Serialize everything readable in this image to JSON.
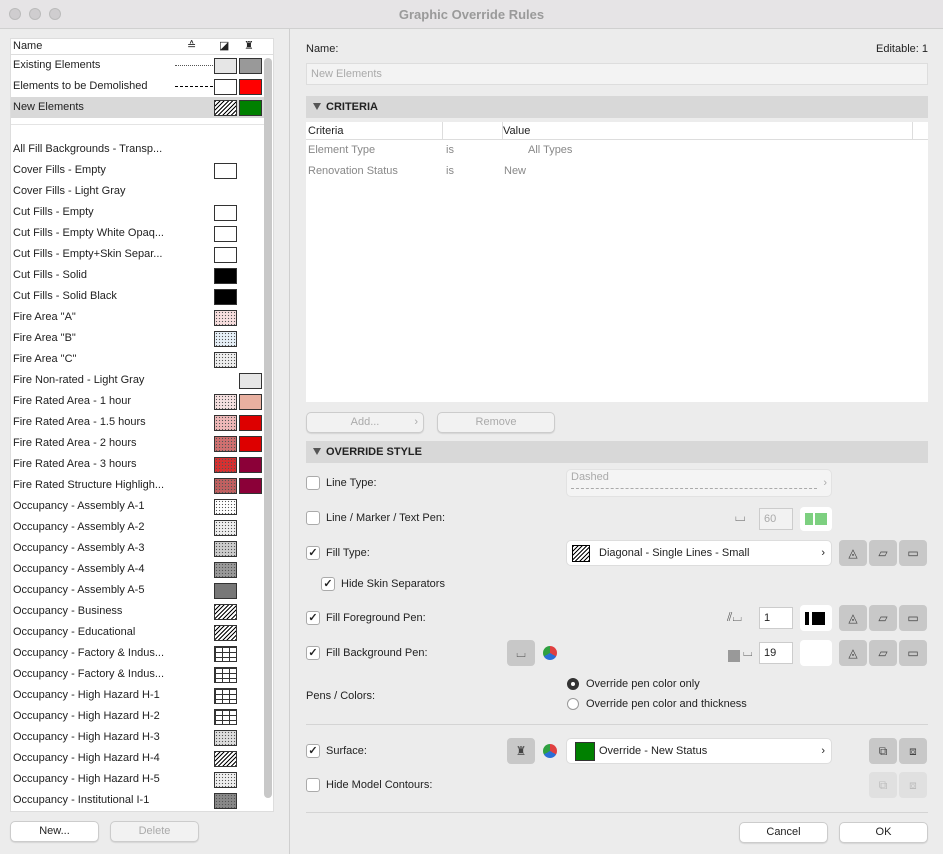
{
  "window": {
    "title": "Graphic Override Rules"
  },
  "list": {
    "headers": {
      "name": "Name",
      "line_icon": "line-type-icon",
      "fill_icon": "fill-icon",
      "surface_icon": "surface-brush-icon"
    },
    "rows": [
      {
        "label": "Existing Elements",
        "line": "dotted",
        "fill": {
          "pattern": "solid",
          "color": "#e6e6e6"
        },
        "surface": "#999999"
      },
      {
        "label": "Elements to be Demolished",
        "line": "dashed",
        "fill": {
          "pattern": "solid",
          "color": "#ffffff"
        },
        "surface": "#ff0000"
      },
      {
        "label": "New Elements",
        "fill": {
          "pattern": "hatch",
          "color": "#ffffff"
        },
        "surface": "#008000",
        "selected": true
      },
      {
        "label": "All Fill Backgrounds - Transp..."
      },
      {
        "label": "Cover Fills - Empty",
        "fill": {
          "pattern": "solid",
          "color": "#ffffff"
        }
      },
      {
        "label": "Cover Fills - Light Gray"
      },
      {
        "label": "Cut Fills - Empty",
        "fill": {
          "pattern": "solid",
          "color": "#ffffff"
        }
      },
      {
        "label": "Cut Fills - Empty White Opaq...",
        "fill": {
          "pattern": "solid",
          "color": "#ffffff"
        }
      },
      {
        "label": "Cut Fills - Empty+Skin Separ...",
        "fill": {
          "pattern": "solid",
          "color": "#ffffff"
        }
      },
      {
        "label": "Cut Fills - Solid",
        "fill": {
          "pattern": "solid",
          "color": "#000000"
        }
      },
      {
        "label": "Cut Fills - Solid Black",
        "fill": {
          "pattern": "solid",
          "color": "#000000"
        }
      },
      {
        "label": "Fire Area \"A\"",
        "fill": {
          "pattern": "dots",
          "color": "#f8dede"
        }
      },
      {
        "label": "Fire Area \"B\"",
        "fill": {
          "pattern": "dots",
          "color": "#e6f0f8"
        }
      },
      {
        "label": "Fire Area \"C\"",
        "fill": {
          "pattern": "dots",
          "color": "#eeeeee"
        }
      },
      {
        "label": "Fire Non-rated - Light Gray",
        "surface": "#e6e6e6"
      },
      {
        "label": "Fire Rated Area - 1 hour",
        "fill": {
          "pattern": "dots",
          "color": "#f6e0e0"
        },
        "surface": "#e8b0a0"
      },
      {
        "label": "Fire Rated Area - 1.5 hours",
        "fill": {
          "pattern": "dots",
          "color": "#f0b8b8"
        },
        "surface": "#dd0000"
      },
      {
        "label": "Fire Rated Area - 2 hours",
        "fill": {
          "pattern": "dots",
          "color": "#d07070"
        },
        "surface": "#dd0000"
      },
      {
        "label": "Fire Rated Area - 3 hours",
        "fill": {
          "pattern": "dots",
          "color": "#d83030"
        },
        "surface": "#8b0038"
      },
      {
        "label": "Fire Rated Structure Highligh...",
        "fill": {
          "pattern": "dots",
          "color": "#c06060"
        },
        "surface": "#8b0038"
      },
      {
        "label": "Occupancy - Assembly A-1",
        "fill": {
          "pattern": "dots",
          "color": "#ffffff"
        }
      },
      {
        "label": "Occupancy - Assembly A-2",
        "fill": {
          "pattern": "dots",
          "color": "#eeeeee"
        }
      },
      {
        "label": "Occupancy - Assembly A-3",
        "fill": {
          "pattern": "dots",
          "color": "#cccccc"
        }
      },
      {
        "label": "Occupancy - Assembly A-4",
        "fill": {
          "pattern": "dots",
          "color": "#999999"
        }
      },
      {
        "label": "Occupancy - Assembly A-5",
        "fill": {
          "pattern": "solid",
          "color": "#777777"
        }
      },
      {
        "label": "Occupancy - Business",
        "fill": {
          "pattern": "hatch",
          "color": "#ffffff"
        }
      },
      {
        "label": "Occupancy - Educational",
        "fill": {
          "pattern": "hatch",
          "color": "#ffffff"
        }
      },
      {
        "label": "Occupancy - Factory & Indus...",
        "fill": {
          "pattern": "grid",
          "color": "#ffffff"
        }
      },
      {
        "label": "Occupancy - Factory & Indus...",
        "fill": {
          "pattern": "grid",
          "color": "#ffffff"
        }
      },
      {
        "label": "Occupancy - High Hazard H-1",
        "fill": {
          "pattern": "grid",
          "color": "#ffffff"
        }
      },
      {
        "label": "Occupancy - High Hazard H-2",
        "fill": {
          "pattern": "grid",
          "color": "#ffffff"
        }
      },
      {
        "label": "Occupancy - High Hazard H-3",
        "fill": {
          "pattern": "dots",
          "color": "#dddddd"
        }
      },
      {
        "label": "Occupancy - High Hazard H-4",
        "fill": {
          "pattern": "hatch",
          "color": "#ffffff"
        }
      },
      {
        "label": "Occupancy - High Hazard H-5",
        "fill": {
          "pattern": "dots",
          "color": "#eeeeee"
        }
      },
      {
        "label": "Occupancy - Institutional I-1",
        "fill": {
          "pattern": "dots",
          "color": "#888888"
        }
      }
    ],
    "new_button": "New...",
    "delete_button": "Delete"
  },
  "detail": {
    "name_label": "Name:",
    "editable": "Editable: 1",
    "name_value": "New Elements",
    "criteria": {
      "title": "CRITERIA",
      "headers": [
        "Criteria",
        "",
        "Value"
      ],
      "rows": [
        {
          "criteria": "Element Type",
          "op": "is",
          "value": "All Types"
        },
        {
          "criteria": "Renovation Status",
          "op": "is",
          "value": "New"
        }
      ],
      "add_button": "Add...",
      "remove_button": "Remove"
    },
    "override": {
      "title": "OVERRIDE STYLE",
      "line_type": {
        "label": "Line Type:",
        "checked": false,
        "value": "Dashed"
      },
      "line_pen": {
        "label": "Line / Marker / Text Pen:",
        "checked": false,
        "pen": "60",
        "color": "#7dd080"
      },
      "fill_type": {
        "label": "Fill Type:",
        "checked": true,
        "value": "Diagonal - Single Lines - Small"
      },
      "hide_skin": {
        "label": "Hide Skin Separators",
        "checked": true
      },
      "fill_fg": {
        "label": "Fill Foreground Pen:",
        "checked": true,
        "pen": "1"
      },
      "fill_bg": {
        "label": "Fill Background Pen:",
        "checked": true,
        "pen": "19"
      },
      "pens_colors": {
        "label": "Pens / Colors:",
        "options": [
          "Override pen color only",
          "Override pen color and thickness"
        ],
        "selected": 0
      },
      "surface": {
        "label": "Surface:",
        "checked": true,
        "value": "Override - New Status",
        "color": "#008000"
      },
      "hide_contours": {
        "label": "Hide Model Contours:",
        "checked": false
      }
    },
    "cancel_button": "Cancel",
    "ok_button": "OK"
  }
}
